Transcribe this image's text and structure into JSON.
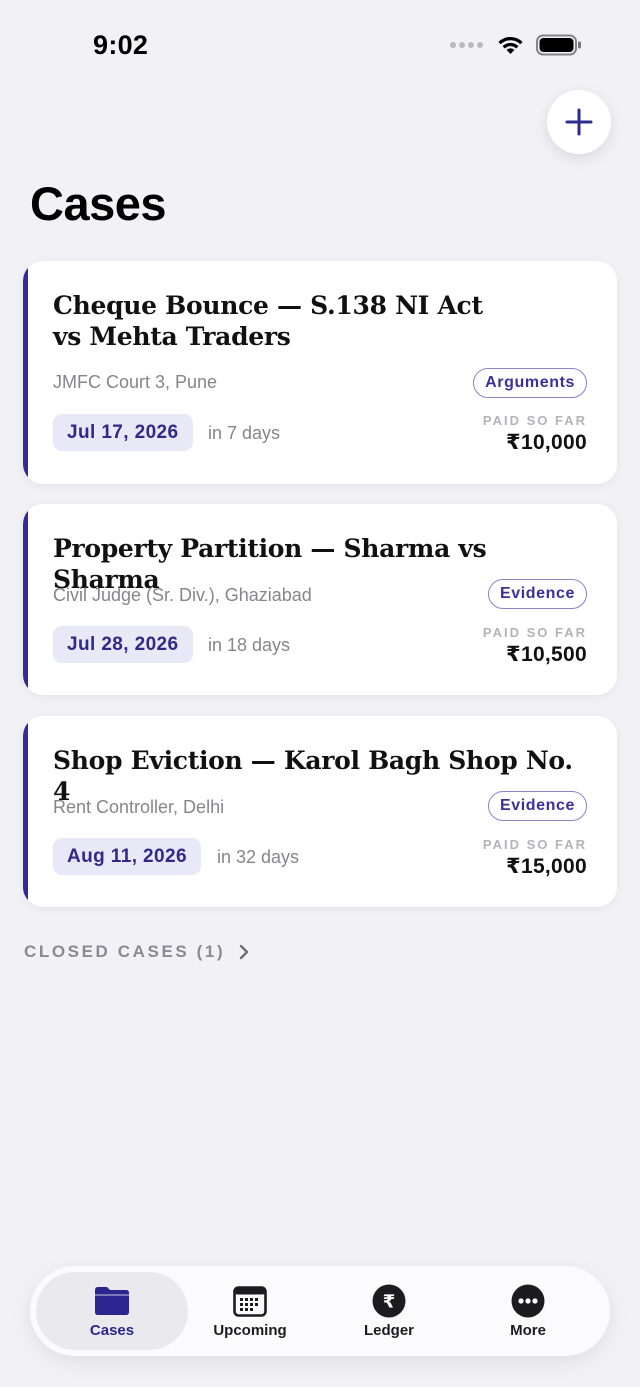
{
  "status_bar": {
    "time": "9:02"
  },
  "header": {
    "title": "Cases",
    "add_icon": "plus-icon"
  },
  "cases": [
    {
      "title": "Cheque Bounce — S.138 NI Act vs Mehta Traders",
      "court": "JMFC Court 3, Pune",
      "stage": "Arguments",
      "date": "Jul 17, 2026",
      "relative": "in 7 days",
      "paid_label": "PAID SO FAR",
      "paid_amount": "₹10,000"
    },
    {
      "title": "Property Partition — Sharma vs Sharma",
      "court": "Civil Judge (Sr. Div.), Ghaziabad",
      "stage": "Evidence",
      "date": "Jul 28, 2026",
      "relative": "in 18 days",
      "paid_label": "PAID SO FAR",
      "paid_amount": "₹10,500"
    },
    {
      "title": "Shop Eviction — Karol Bagh Shop No. 4",
      "court": "Rent Controller, Delhi",
      "stage": "Evidence",
      "date": "Aug 11, 2026",
      "relative": "in 32 days",
      "paid_label": "PAID SO FAR",
      "paid_amount": "₹15,000"
    }
  ],
  "closed_cases": {
    "label": "CLOSED CASES (1)",
    "icon": "chevron-right-icon"
  },
  "tab_bar": {
    "tabs": [
      {
        "label": "Cases",
        "icon": "folder-icon",
        "active": true
      },
      {
        "label": "Upcoming",
        "icon": "calendar-icon",
        "active": false
      },
      {
        "label": "Ledger",
        "icon": "rupee-icon",
        "active": false
      },
      {
        "label": "More",
        "icon": "more-icon",
        "active": false
      }
    ]
  },
  "colors": {
    "accent": "#322a96",
    "background": "#f1f1f6",
    "date_chip": "#e9e8f7",
    "badge_border": "#8a84c6"
  }
}
